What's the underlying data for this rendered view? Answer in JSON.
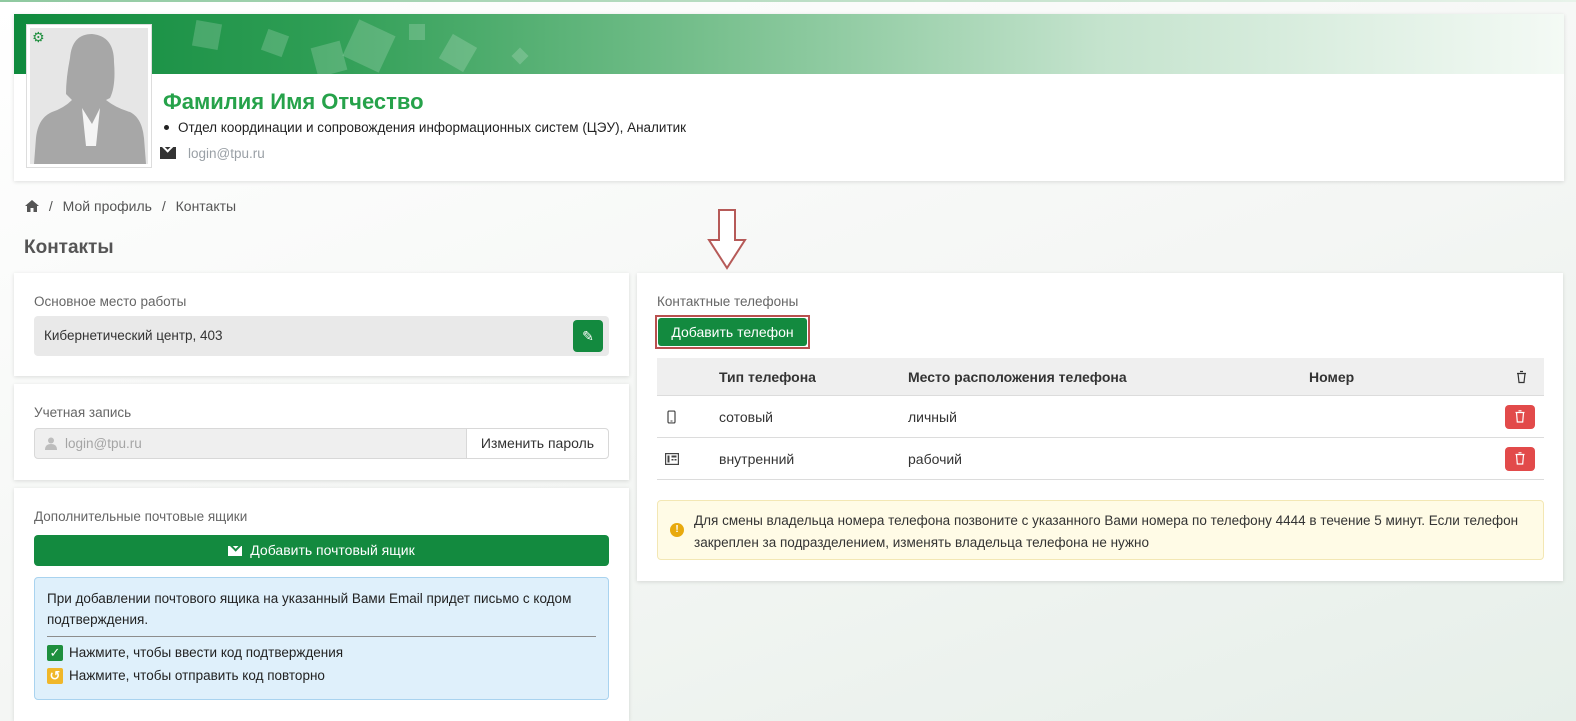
{
  "profile": {
    "full_name": "Фамилия Имя Отчество",
    "department": "Отдел координации и сопровождения информационных систем (ЦЭУ), Аналитик",
    "email": "login@tpu.ru"
  },
  "breadcrumb": {
    "items": [
      "Мой профиль",
      "Контакты"
    ],
    "separator": "/"
  },
  "page_title": "Контакты",
  "workplace": {
    "title": "Основное место работы",
    "value": "Кибернетический центр, 403"
  },
  "account": {
    "title": "Учетная запись",
    "login": "login@tpu.ru",
    "change_password_label": "Изменить пароль"
  },
  "mailboxes": {
    "title": "Дополнительные почтовые ящики",
    "add_label": "Добавить почтовый ящик",
    "info_text": "При добавлении почтового ящика на указанный Вами Email придет письмо с кодом подтверждения.",
    "enter_code_label": "Нажмите, чтобы ввести код подтверждения",
    "resend_code_label": "Нажмите, чтобы отправить код повторно"
  },
  "phones": {
    "title": "Контактные телефоны",
    "add_label": "Добавить телефон",
    "columns": [
      "Тип телефона",
      "Место расположения телефона",
      "Номер"
    ],
    "rows": [
      {
        "icon": "mobile-phone-icon",
        "type": "сотовый",
        "location": "личный",
        "number": ""
      },
      {
        "icon": "desk-phone-icon",
        "type": "внутренний",
        "location": "рабочий",
        "number": ""
      }
    ],
    "notice": "Для смены владельца номера телефона позвоните с указанного Вами номера по телефону 4444 в течение 5 минут. Если телефон закреплен за подразделением, изменять владельца телефона не нужно"
  },
  "colors": {
    "brand_green": "#138a3f",
    "name_green": "#26a24a",
    "danger_red": "#e24a4a",
    "highlight_border": "#b9504f"
  }
}
